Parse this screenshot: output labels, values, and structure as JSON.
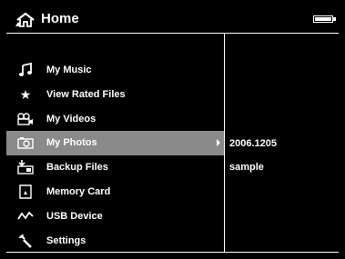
{
  "header": {
    "title": "Home",
    "icon": "home-icon",
    "battery_level": 1.0
  },
  "menu": {
    "items": [
      {
        "label": "My Music",
        "icon": "music-note-icon"
      },
      {
        "label": "View Rated Files",
        "icon": "star-icon"
      },
      {
        "label": "My Videos",
        "icon": "video-camera-icon"
      },
      {
        "label": "My Photos",
        "icon": "camera-icon",
        "selected": true
      },
      {
        "label": "Backup Files",
        "icon": "backup-icon"
      },
      {
        "label": "Memory Card",
        "icon": "memory-card-icon"
      },
      {
        "label": "USB Device",
        "icon": "usb-icon"
      },
      {
        "label": "Settings",
        "icon": "wrench-icon"
      }
    ]
  },
  "details": {
    "date": "2006.1205",
    "name": "sample"
  },
  "colors": {
    "background": "#000000",
    "text": "#ffffff",
    "selection": "#8a8a8a"
  }
}
